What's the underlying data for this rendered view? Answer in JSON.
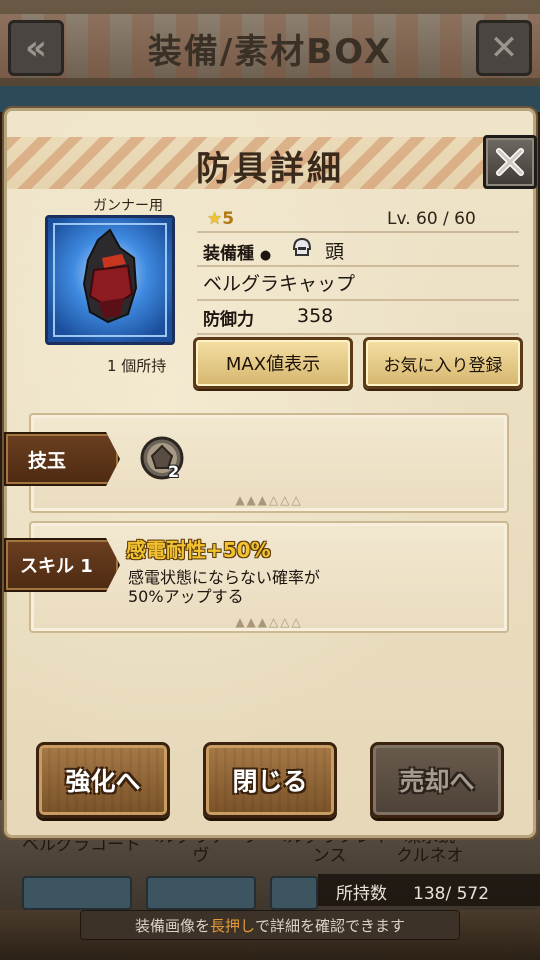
{
  "background": {
    "title": "装備/素材BOX",
    "back_icon": "back-arrow-icon",
    "close_icon": "close-icon",
    "list_names": [
      "ベルグラコート",
      "ベルグラテープ\nヴ",
      "ベルグラフレイ\nンス",
      "凍氷銃\nクルネオ"
    ],
    "count_label": "所持数",
    "count_value": "138/ 572",
    "hint_before": "装備画像を",
    "hint_highlight": "長押し",
    "hint_after": "で詳細を確認できます"
  },
  "dialog": {
    "title": "防具詳細",
    "close_icon": "close-icon",
    "user_type": "ガンナー用",
    "owned": "1 個所持",
    "rarity_star": "★",
    "rarity": "5",
    "level": "Lv.  60 / 60",
    "equip_type_label": "装備種",
    "equip_type_icon": "helmet-icon",
    "equip_type_value": "頭",
    "item_name": "ベルグラキャップ",
    "defense_label": "防御力",
    "defense_value": "358",
    "max_button": "MAX値表示",
    "favorite_button": "お気に入り登録",
    "gem_tag": "技玉",
    "gem_icon": "gem-icon",
    "gem_count": "2",
    "skill_tag": "スキル 1",
    "skill_name": "感電耐性+50%",
    "skill_desc_1": "感電状態にならない確率が",
    "skill_desc_2": "50%アップする",
    "enhance_button": "強化へ",
    "close_button": "閉じる",
    "sell_button": "売却へ"
  }
}
